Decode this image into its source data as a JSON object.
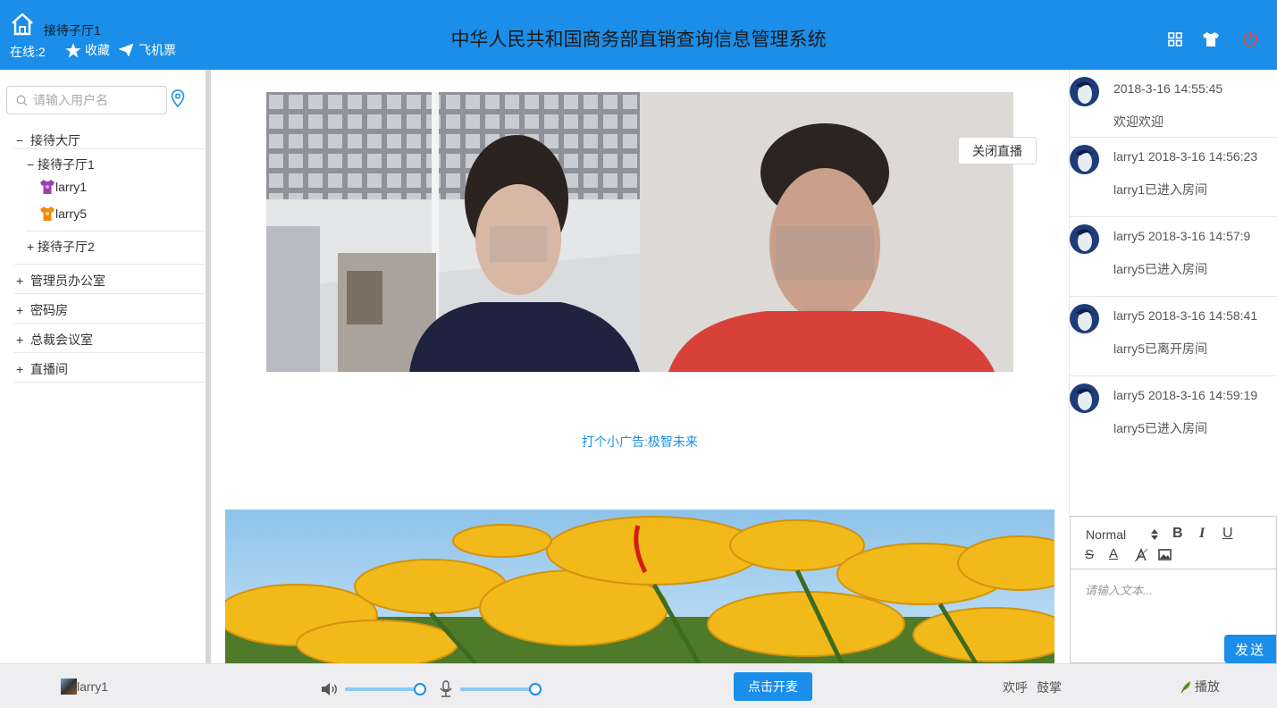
{
  "header": {
    "room_name": "接待子厅1",
    "online": "在线:2",
    "favorites": "收藏",
    "flight": "飞机票",
    "title": "中华人民共和国商务部直销查询信息管理系统",
    "bg_color": "#1a8ee8"
  },
  "sidebar": {
    "search_placeholder": "请输入用户名",
    "tree": {
      "hall": "接待大厅",
      "sub1": "接待子厅1",
      "users": [
        "larry1",
        "larry5"
      ],
      "sub2": "接待子厅2",
      "rooms": [
        "管理员办公室",
        "密码房",
        "总裁会议室",
        "直播间"
      ]
    },
    "collapse_symbol": "−",
    "expand_symbol": "+"
  },
  "main": {
    "close_live": "关闭直播",
    "ad": "打个小广告:极智未来"
  },
  "chat": {
    "messages": [
      {
        "meta": "2018-3-16 14:55:45",
        "text": "欢迎欢迎"
      },
      {
        "meta": "larry1 2018-3-16 14:56:23",
        "text": "larry1已进入房间"
      },
      {
        "meta": "larry5 2018-3-16 14:57:9",
        "text": "larry5已进入房间"
      },
      {
        "meta": "larry5 2018-3-16 14:58:41",
        "text": "larry5已离开房间"
      },
      {
        "meta": "larry5 2018-3-16 14:59:19",
        "text": "larry5已进入房间"
      }
    ]
  },
  "editor": {
    "format": "Normal",
    "bold": "B",
    "italic": "I",
    "underline": "U",
    "strike": "S",
    "color": "A",
    "placeholder": "请输入文本...",
    "send": "发送"
  },
  "footer": {
    "user": "larry1",
    "volume_level": 0.98,
    "mic_level": 0.98,
    "mic_button": "点击开麦",
    "cheer": "欢呼",
    "applause": "鼓掌",
    "play": "播放"
  }
}
